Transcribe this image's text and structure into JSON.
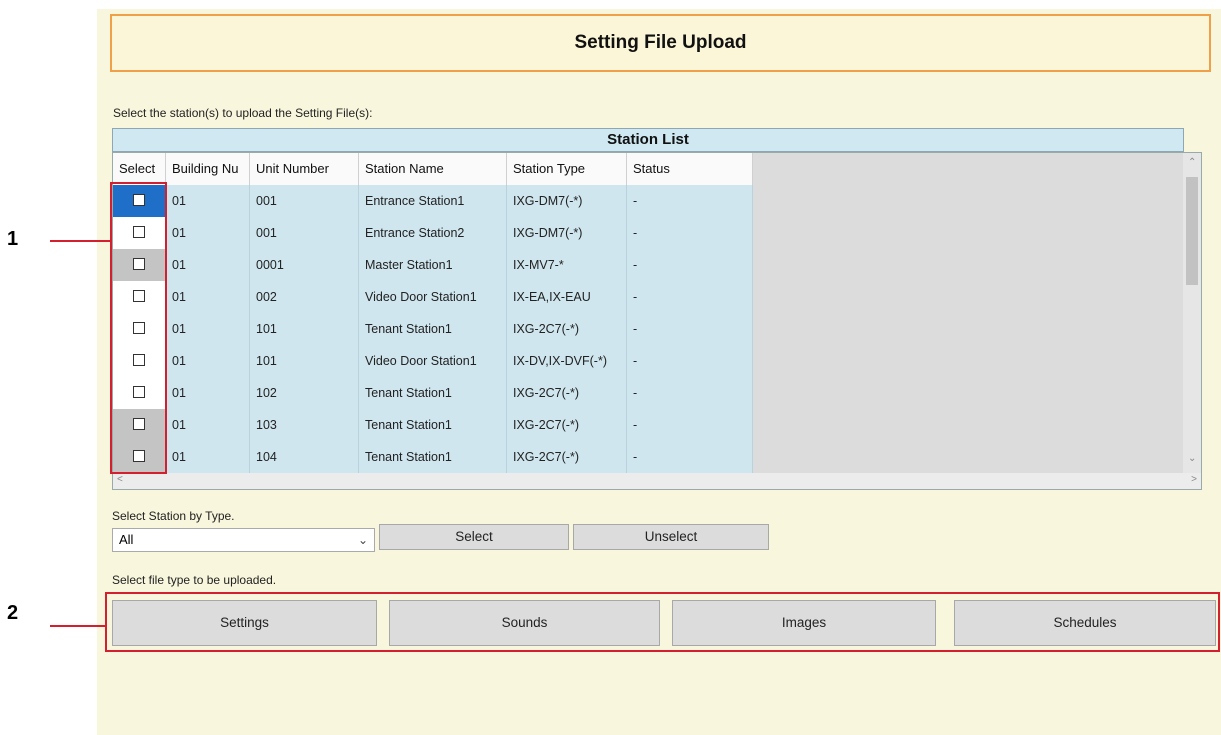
{
  "title": "Setting File Upload",
  "instruction": "Select the station(s) to upload the Setting File(s):",
  "table": {
    "title": "Station List",
    "columns": [
      "Select",
      "Building Nu",
      "Unit Number",
      "Station Name",
      "Station Type",
      "Status"
    ],
    "rows": [
      {
        "building": "01",
        "unit": "001",
        "name": "Entrance Station1",
        "type": "IXG-DM7(-*)",
        "status": "-"
      },
      {
        "building": "01",
        "unit": "001",
        "name": "Entrance Station2",
        "type": "IXG-DM7(-*)",
        "status": "-"
      },
      {
        "building": "01",
        "unit": "0001",
        "name": "Master Station1",
        "type": "IX-MV7-*",
        "status": "-"
      },
      {
        "building": "01",
        "unit": "002",
        "name": "Video Door Station1",
        "type": "IX-EA,IX-EAU",
        "status": "-"
      },
      {
        "building": "01",
        "unit": "101",
        "name": "Tenant Station1",
        "type": "IXG-2C7(-*)",
        "status": "-"
      },
      {
        "building": "01",
        "unit": "101",
        "name": "Video Door Station1",
        "type": "IX-DV,IX-DVF(-*)",
        "status": "-"
      },
      {
        "building": "01",
        "unit": "102",
        "name": "Tenant Station1",
        "type": "IXG-2C7(-*)",
        "status": "-"
      },
      {
        "building": "01",
        "unit": "103",
        "name": "Tenant Station1",
        "type": "IXG-2C7(-*)",
        "status": "-"
      },
      {
        "building": "01",
        "unit": "104",
        "name": "Tenant Station1",
        "type": "IXG-2C7(-*)",
        "status": "-"
      }
    ]
  },
  "select_by_type": {
    "label": "Select Station by Type.",
    "value": "All",
    "select_label": "Select",
    "unselect_label": "Unselect"
  },
  "file_type": {
    "label": "Select file type to be uploaded.",
    "buttons": [
      "Settings",
      "Sounds",
      "Images",
      "Schedules"
    ]
  },
  "callouts": [
    "1",
    "2"
  ],
  "icons": {
    "dropdown": "chevron-down-icon",
    "scroll_up": "scroll-up-icon",
    "scroll_down": "scroll-down-icon"
  },
  "colors": {
    "accent_border": "#f0a048",
    "callout_red": "#d4202e",
    "table_row": "#cfe6ee"
  }
}
